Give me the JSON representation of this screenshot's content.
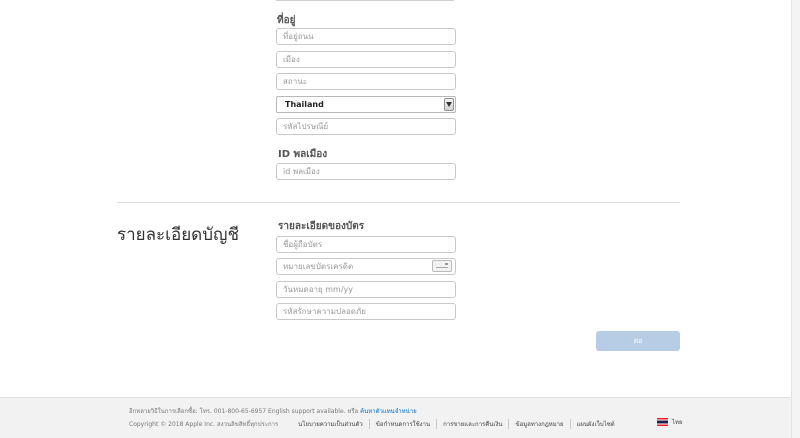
{
  "address": {
    "heading": "ที่อยู่",
    "street_placeholder": "ที่อยู่ถนน",
    "city_placeholder": "เมือง",
    "state_placeholder": "สถานะ",
    "country_value": "Thailand",
    "postal_placeholder": "รหัสไปรษณีย์"
  },
  "citizen": {
    "heading": "ID พลเมือง",
    "id_placeholder": "id พลเมือง"
  },
  "account": {
    "section_title": "รายละเอียดบัญชี",
    "card_heading": "รายละเอียดของบัตร",
    "cardholder_placeholder": "ชื่อผู้ถือบัตร",
    "card_number_placeholder": "หมายเลขบัตรเครดิต",
    "expiry_placeholder": "วันหมดอายุ mm/yy",
    "cvv_placeholder": "รหัสรักษาความปลอดภัย",
    "submit_label": "ต่อ"
  },
  "footer": {
    "shop_text": "อีกหลายวิธีในการเลือกซื้อ: โทร. 001-800-65-6957 English support available. หรือ",
    "reseller_link": "ค้นหาตัวแทนจำหน่าย",
    "copyright": "Copyright © 2018 Apple Inc. สงวนลิขสิทธิ์ทุกประการ",
    "links": [
      "นโยบายความเป็นส่วนตัว",
      "ข้อกำหนดการใช้งาน",
      "การขายและการคืนเงิน",
      "ข้อมูลทางกฎหมาย",
      "แผนผังเว็บไซต์"
    ],
    "locale_label": "ไทย",
    "flag_icon": "thailand-flag-icon"
  },
  "colors": {
    "submit_button": "#b7cde6",
    "link": "#0070c9",
    "footer_bg": "#f2f2f2"
  }
}
